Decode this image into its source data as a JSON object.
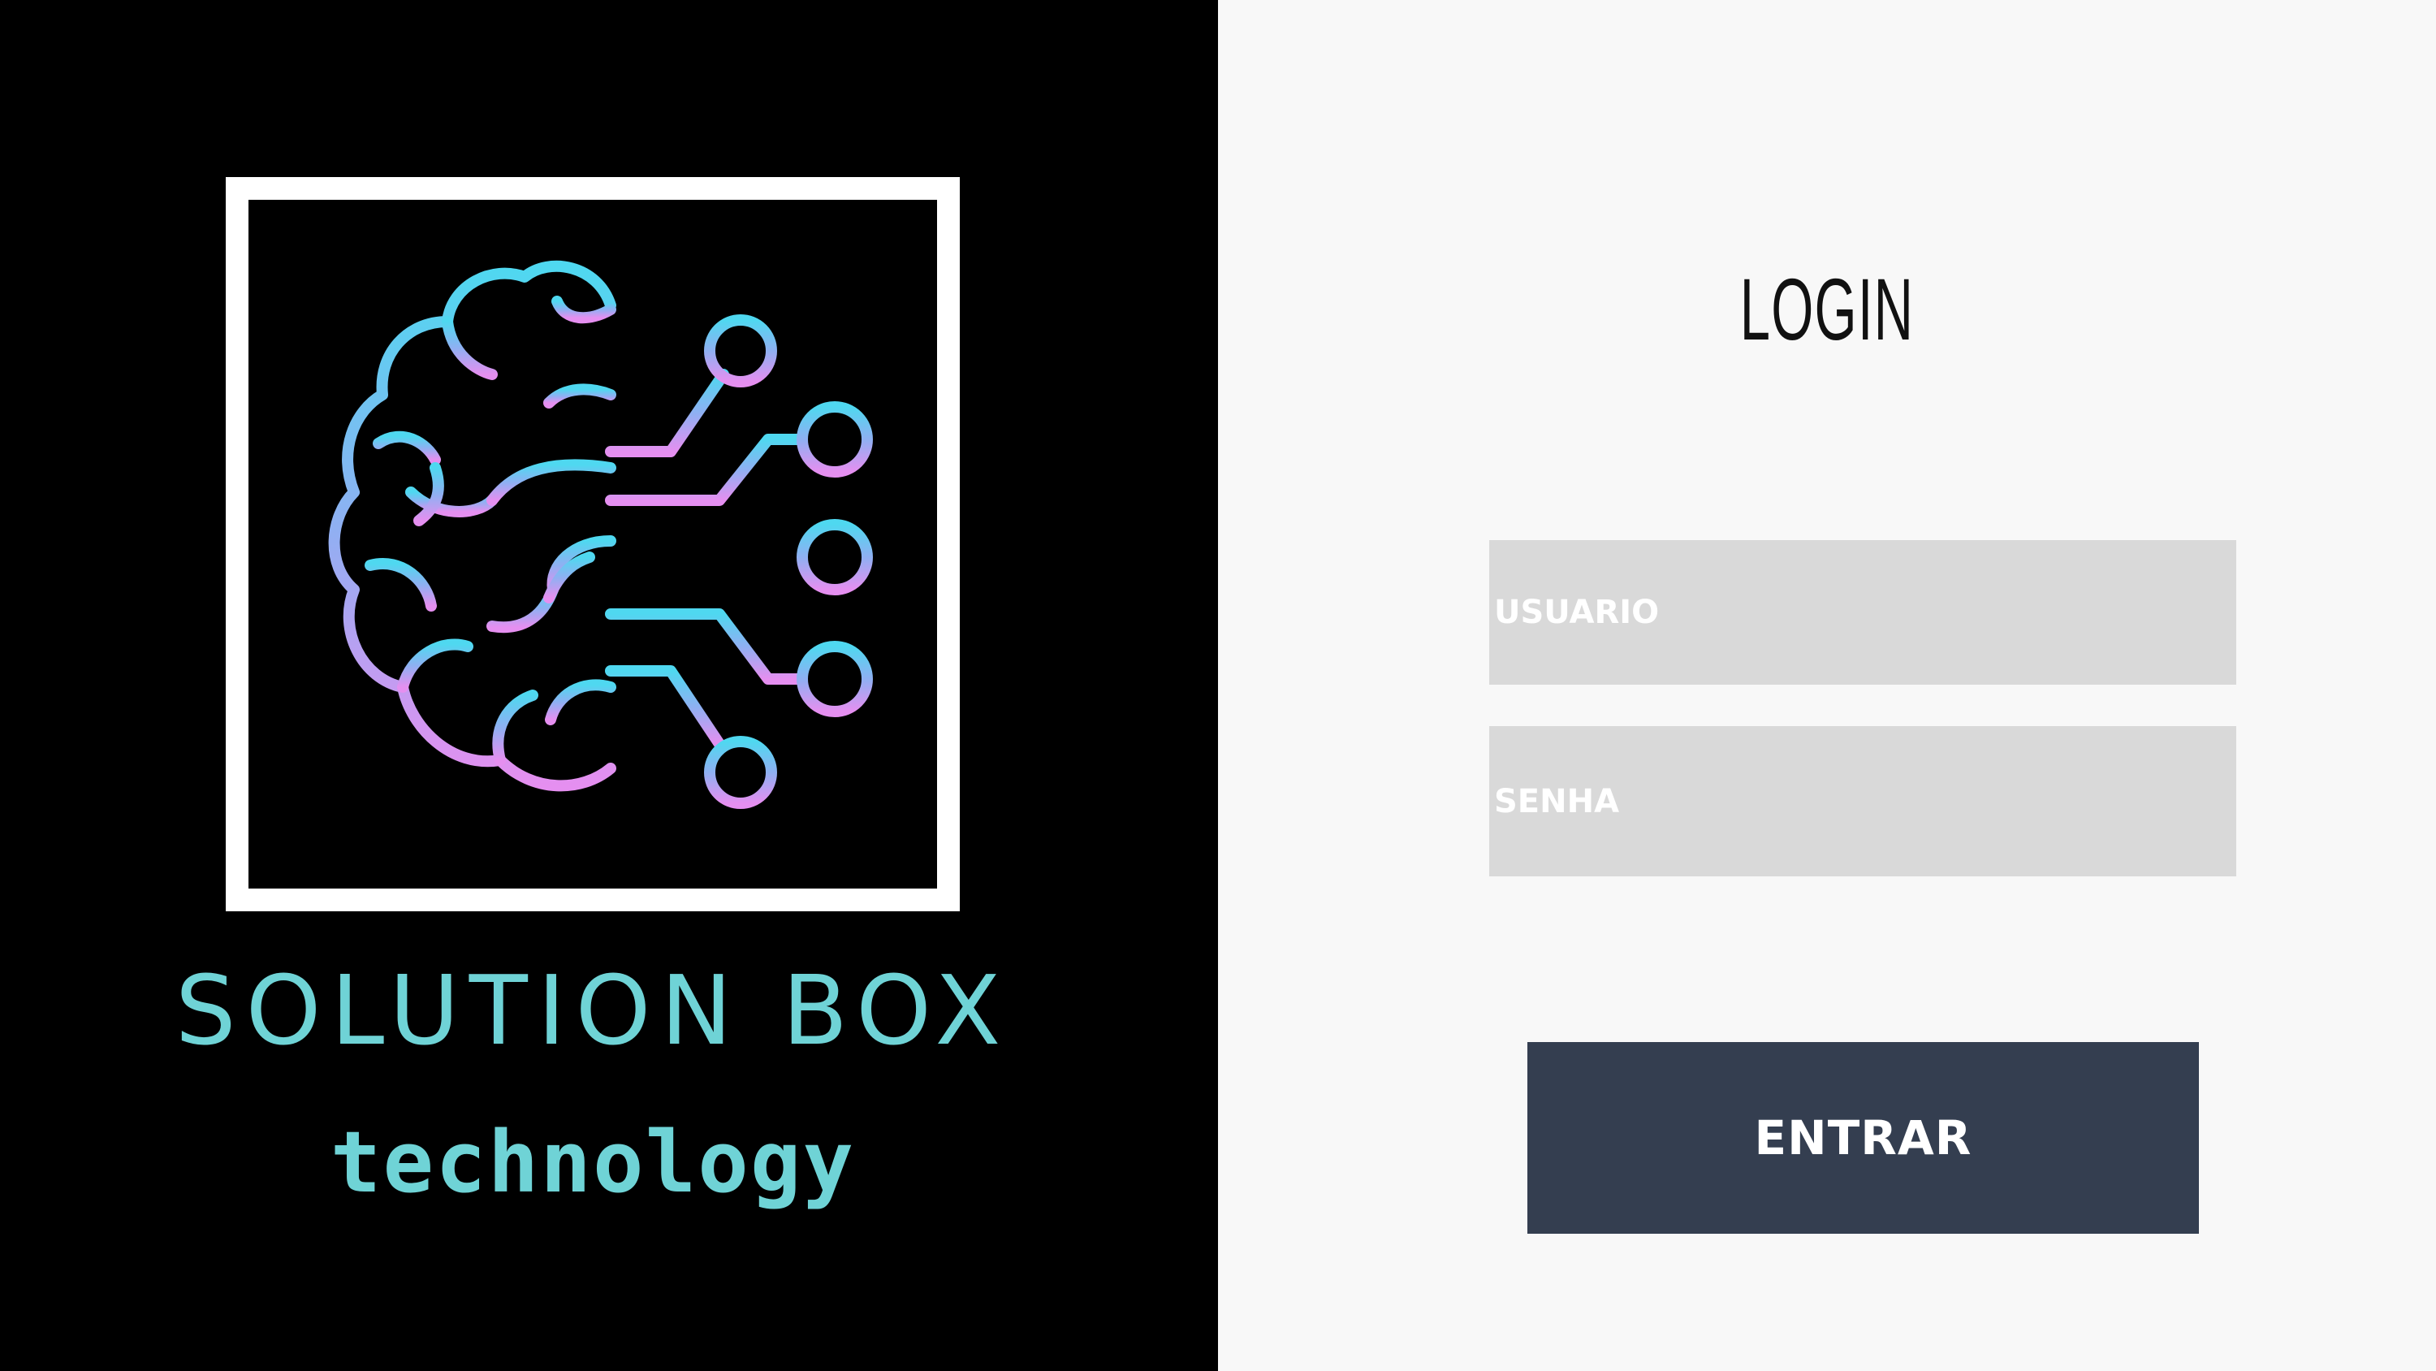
{
  "brand": {
    "name": "SOLUTION BOX",
    "tagline": "technology",
    "logo_icon": "brain-circuit-icon",
    "colors": {
      "text": "#6fd3d6",
      "gradient_top": "#4fd8f0",
      "gradient_bottom": "#e58ff0"
    }
  },
  "login": {
    "title": "LOGIN",
    "username_placeholder": "USUARIO",
    "password_placeholder": "SENHA",
    "submit_label": "ENTRAR",
    "button_color": "#343e50",
    "field_color": "#d9d9d9"
  }
}
